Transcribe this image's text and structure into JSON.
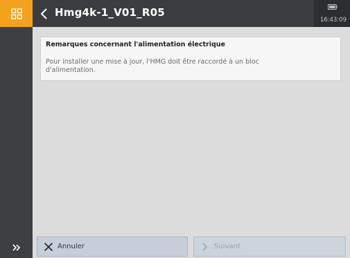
{
  "sidebar": {
    "home_icon": "grid-icon",
    "expand_icon": "double-chevron-right-icon"
  },
  "header": {
    "title": "Hmg4k-1_V01_R05",
    "back_icon": "chevron-left-icon",
    "battery_icon": "battery-icon",
    "time": "16:43:09"
  },
  "notice": {
    "title": "Remarques concernant l'alimentation électrique",
    "body": "Pour installer une mise à jour, l'HMG doit être raccordé à un bloc d'alimentation."
  },
  "footer": {
    "cancel_label": "Annuler",
    "cancel_icon": "close-icon",
    "next_label": "Suivant",
    "next_icon": "chevron-right-icon"
  },
  "colors": {
    "accent": "#f4a21c",
    "header_bg": "#3a3c3f",
    "sidebar_bg": "#3d3f42",
    "content_bg": "#dcdcdc",
    "button_bg": "#c6cfd9"
  }
}
